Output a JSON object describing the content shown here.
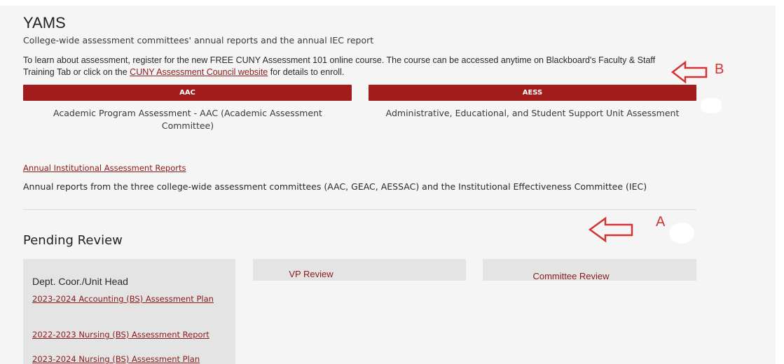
{
  "page": {
    "title": "YAMS",
    "subtitle": "College-wide assessment committees' annual reports and the annual IEC report",
    "intro": {
      "before_link": "To learn about assessment, register for the new FREE CUNY Assessment 101 online course. The course can be accessed anytime on Blackboard's Faculty & Staff Training Tab or click on the ",
      "link_text": "CUNY Assessment Council website",
      "after_link": " for details to enroll."
    }
  },
  "buttons": {
    "aac_label": "AAC",
    "aess_label": "AESS"
  },
  "descriptions": {
    "aac": "Academic Program Assessment - AAC (Academic Assessment Committee)",
    "aess": "Administrative, Educational, and Student Support Unit Assessment"
  },
  "annual": {
    "link_text": "Annual Institutional Assessment Reports",
    "description": "Annual reports from the three college-wide assessment committees (AAC, GEAC, AESSAC) and the Institutional Effectiveness Committee (IEC)"
  },
  "pending": {
    "title": "Pending Review",
    "columns": {
      "dept": "Dept. Coor./Unit Head",
      "vp": "VP Review",
      "committee": "Committee Review"
    },
    "items": [
      "2023-2024 Accounting (BS) Assessment Plan",
      "2022-2023 Nursing (BS) Assessment Report",
      "2023-2024 Nursing (BS) Assessment Plan"
    ]
  },
  "annotations": {
    "a": "A",
    "b": "B",
    "color": "#d23434"
  },
  "colors": {
    "brand_red": "#a31c1c",
    "link_red": "#8b1a1a",
    "background": "#f5f5f5"
  }
}
